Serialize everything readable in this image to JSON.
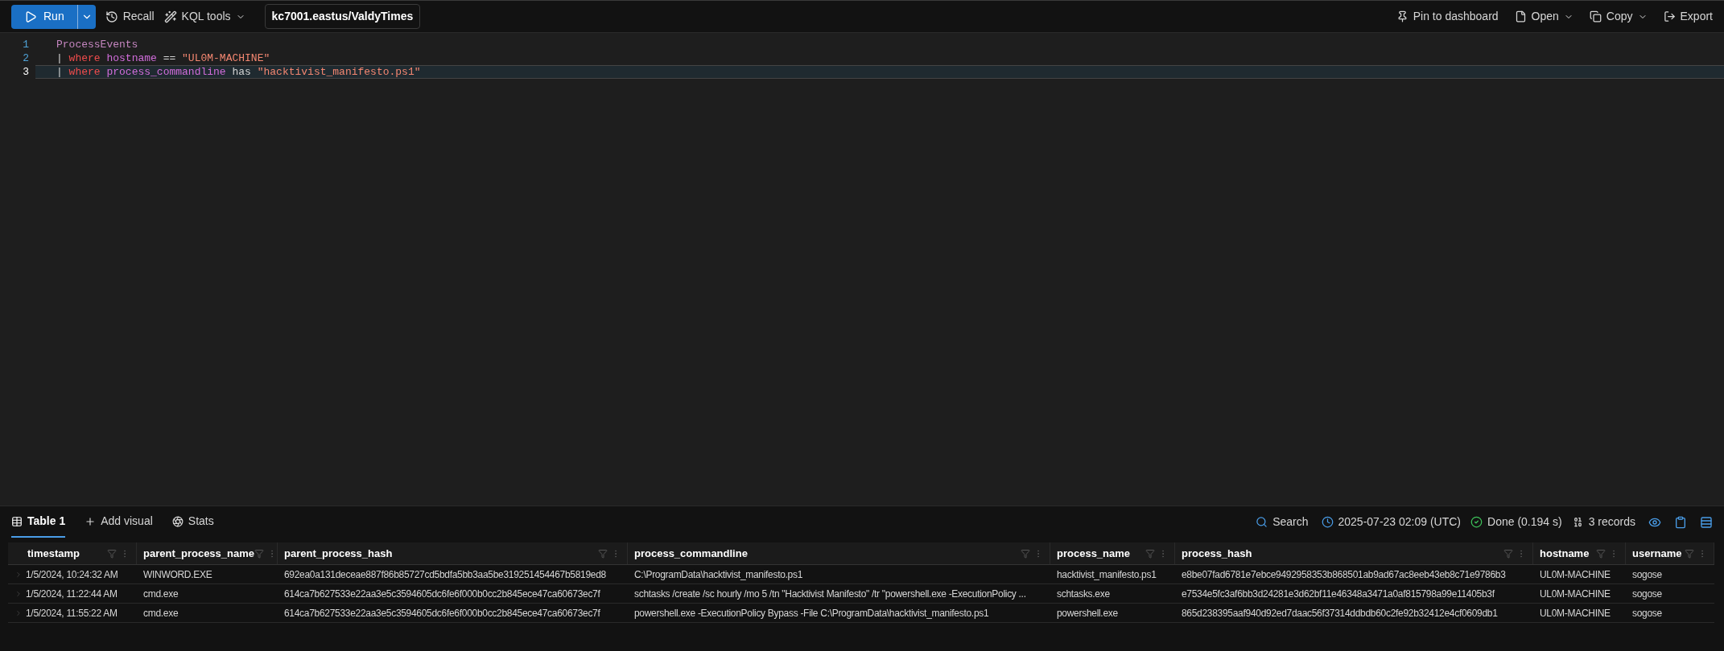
{
  "toolbar": {
    "run": "Run",
    "recall": "Recall",
    "kql_tools": "KQL tools",
    "database": "kc7001.eastus/ValdyTimes",
    "actions": [
      {
        "label": "Pin to dashboard",
        "kind": "pin",
        "caret": false
      },
      {
        "label": "Open",
        "kind": "file",
        "caret": true
      },
      {
        "label": "Copy",
        "kind": "copy",
        "caret": true
      },
      {
        "label": "Export",
        "kind": "export",
        "caret": false
      }
    ]
  },
  "editor": {
    "lines": [
      {
        "number": "1",
        "selected": false,
        "tokens": [
          {
            "kind": "table",
            "text": "ProcessEvents"
          }
        ]
      },
      {
        "number": "2",
        "selected": false,
        "tokens": [
          {
            "kind": "pipe",
            "text": "| "
          },
          {
            "kind": "keyword",
            "text": "where "
          },
          {
            "kind": "field",
            "text": "hostname "
          },
          {
            "kind": "op",
            "text": "== "
          },
          {
            "kind": "string",
            "text": "\"UL0M-MACHINE\""
          }
        ]
      },
      {
        "number": "3",
        "selected": true,
        "tokens": [
          {
            "kind": "pipe",
            "text": "| "
          },
          {
            "kind": "keyword",
            "text": "where "
          },
          {
            "kind": "field",
            "text": "process_commandline "
          },
          {
            "kind": "op",
            "text": "has "
          },
          {
            "kind": "string",
            "text": "\"hacktivist_manifesto.ps1\""
          }
        ]
      }
    ]
  },
  "results": {
    "tabs": [
      {
        "label": "Table 1",
        "kind": "table",
        "selected": true
      },
      {
        "label": "Add visual",
        "kind": "add",
        "selected": false
      },
      {
        "label": "Stats",
        "kind": "stats",
        "selected": false
      }
    ],
    "search": "Search",
    "time": "2025-07-23 02:09 (UTC)",
    "status": "Done (0.194 s)",
    "records": "3 records",
    "table": {
      "columns": [
        "timestamp",
        "parent_process_name",
        "parent_process_hash",
        "process_commandline",
        "process_name",
        "process_hash",
        "hostname",
        "username"
      ],
      "rows": [
        [
          "1/5/2024, 10:24:32 AM",
          "WINWORD.EXE",
          "692ea0a131deceae887f86b85727cd5bdfa5bb3aa5be319251454467b5819ed8",
          "C:\\ProgramData\\hacktivist_manifesto.ps1",
          "hacktivist_manifesto.ps1",
          "e8be07fad6781e7ebce9492958353b868501ab9ad67ac8eeb43eb8c71e9786b3",
          "UL0M-MACHINE",
          "sogose"
        ],
        [
          "1/5/2024, 11:22:44 AM",
          "cmd.exe",
          "614ca7b627533e22aa3e5c3594605dc6fe6f000b0cc2b845ece47ca60673ec7f",
          "schtasks /create /sc hourly /mo 5 /tn \"Hacktivist Manifesto\" /tr \"powershell.exe -ExecutionPolicy ...",
          "schtasks.exe",
          "e7534e5fc3af6bb3d24281e3d62bf11e46348a3471a0af815798a99e11405b3f",
          "UL0M-MACHINE",
          "sogose"
        ],
        [
          "1/5/2024, 11:55:22 AM",
          "cmd.exe",
          "614ca7b627533e22aa3e5c3594605dc6fe6f000b0cc2b845ece47ca60673ec7f",
          "powershell.exe -ExecutionPolicy Bypass -File C:\\ProgramData\\hacktivist_manifesto.ps1",
          "powershell.exe",
          "865d238395aaf940d92ed7daac56f37314ddbdb60c2fe92b32412e4cf0609db1",
          "UL0M-MACHINE",
          "sogose"
        ]
      ]
    }
  }
}
